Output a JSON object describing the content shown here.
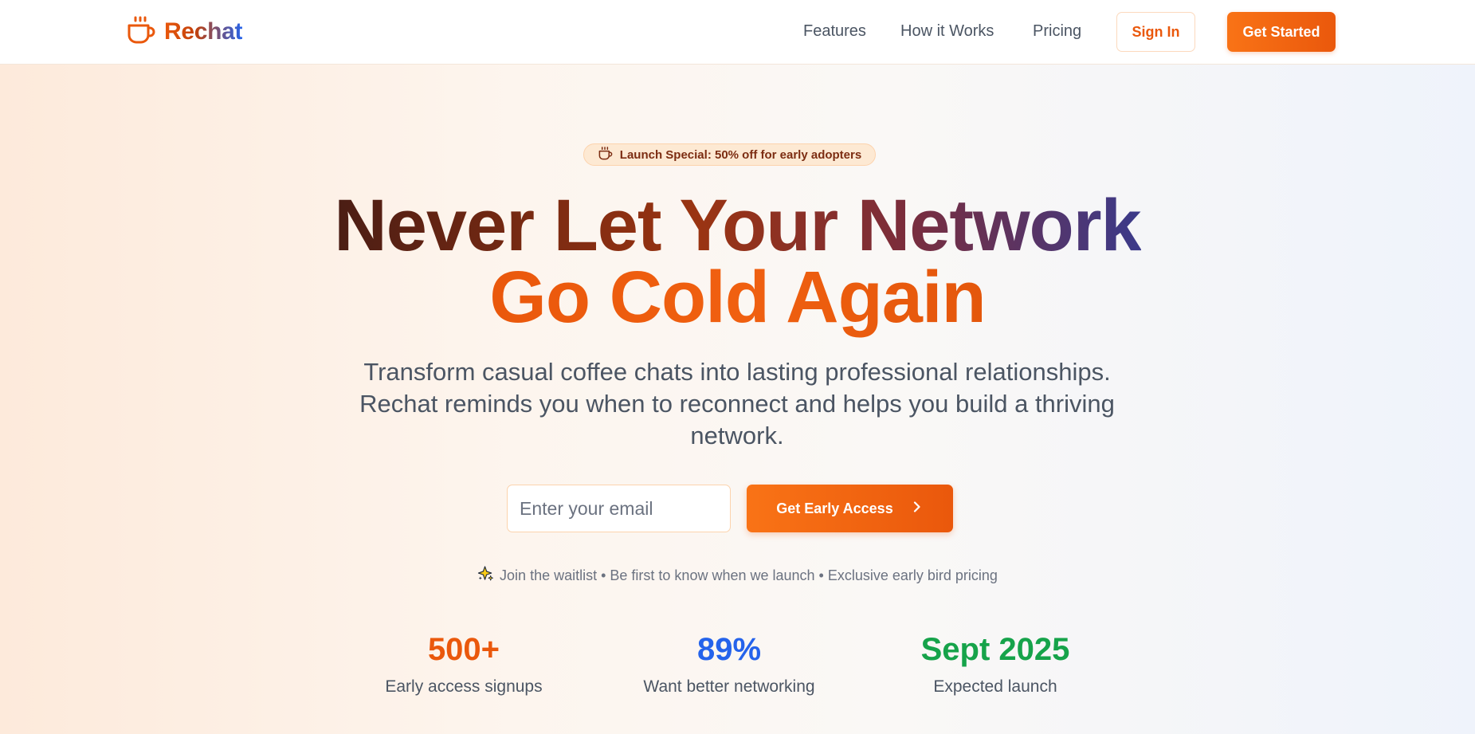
{
  "header": {
    "brand": "Rechat",
    "nav": {
      "features": "Features",
      "how_it_works": "How it Works",
      "pricing": "Pricing"
    },
    "sign_in": "Sign In",
    "get_started": "Get Started",
    "accent_color": "#ea580c"
  },
  "hero": {
    "badge": "Launch Special: 50% off for early adopters",
    "headline_line1": "Never Let Your Network",
    "headline_line2": "Go Cold Again",
    "subtitle": "Transform casual coffee chats into lasting professional relationships. Rechat reminds you when to reconnect and helps you build a thriving network.",
    "email_placeholder": "Enter your email",
    "cta": "Get Early Access",
    "note": "Join the waitlist • Be first to know when we launch • Exclusive early bird pricing"
  },
  "stats": [
    {
      "value": "500+",
      "label": "Early access signups",
      "color": "#ea580c"
    },
    {
      "value": "89%",
      "label": "Want better networking",
      "color": "#2563eb"
    },
    {
      "value": "Sept 2025",
      "label": "Expected launch",
      "color": "#16a34a"
    }
  ],
  "icons": {
    "logo": "coffee-cup-icon",
    "badge": "coffee-cup-icon",
    "cta": "chevron-right-icon",
    "note": "sparkles-icon"
  }
}
